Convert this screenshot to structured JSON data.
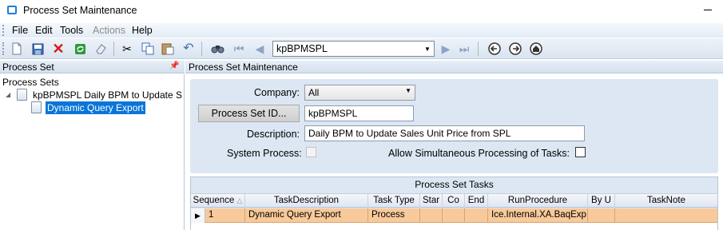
{
  "window": {
    "title": "Process Set Maintenance"
  },
  "menu": [
    "File",
    "Edit",
    "Tools",
    "Actions",
    "Help"
  ],
  "toolbar": {
    "icons": [
      "new-icon",
      "save-icon",
      "delete-icon",
      "refresh-icon",
      "clear-icon",
      "cut-icon",
      "copy-icon",
      "paste-icon",
      "undo-icon",
      "search-icon",
      "first-icon",
      "prev-icon",
      "next-icon",
      "last-icon",
      "back-icon",
      "forward-icon",
      "home-icon"
    ],
    "record_combo_value": "kpBPMSPL"
  },
  "left_panel": {
    "header": "Process Set",
    "pin": "†",
    "tree": {
      "root": "Process Sets",
      "node": "kpBPMSPL  Daily BPM to Update S",
      "child": "Dynamic Query Export"
    }
  },
  "right_panel": {
    "header": "Process Set Maintenance",
    "form": {
      "company_label": "Company:",
      "company_value": "All",
      "process_set_button": "Process Set ID...",
      "process_set_value": "kpBPMSPL",
      "description_label": "Description:",
      "description_value": "Daily BPM to Update Sales Unit Price from SPL",
      "system_process_label": "System Process:",
      "system_process_checked": false,
      "simultaneous_label": "Allow Simultaneous Processing of Tasks:",
      "simultaneous_checked": false
    },
    "grid": {
      "title": "Process Set Tasks",
      "columns": [
        "Sequence",
        "TaskDescription",
        "Task Type",
        "Star",
        "Co",
        "End",
        "RunProcedure",
        "By U",
        "TaskNote"
      ],
      "sort_indicator": "△",
      "rows": [
        {
          "sequence": "1",
          "task_description": "Dynamic Query Export",
          "task_type": "Process",
          "star": "",
          "co": "",
          "end": "",
          "run_procedure": "Ice.Internal.XA.BaqExp",
          "by_u": "",
          "task_note": ""
        }
      ]
    }
  }
}
